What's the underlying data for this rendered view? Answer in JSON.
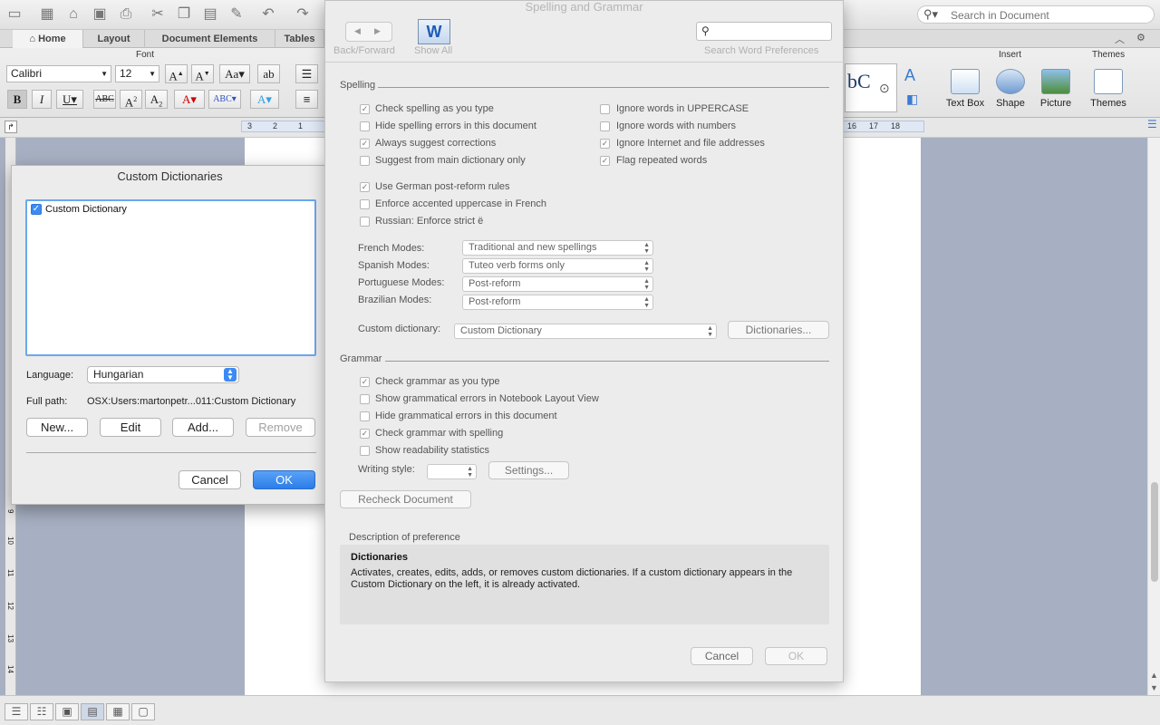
{
  "toolbar": {
    "search_placeholder": "Search in Document"
  },
  "tabs": [
    "Home",
    "Layout",
    "Document Elements",
    "Tables"
  ],
  "ribbon": {
    "font_group_title": "Font",
    "font_name": "Calibri",
    "font_size": "12",
    "insert_group_title": "Insert",
    "themes_group_title": "Themes",
    "text_box": "Text Box",
    "shape": "Shape",
    "picture": "Picture",
    "themes": "Themes",
    "style_preview": "bC"
  },
  "ruler": {
    "left_marks": [
      "3",
      "2",
      "1"
    ],
    "right_marks": [
      "16",
      "17",
      "18"
    ]
  },
  "vruler": {
    "marks": [
      "9",
      "10",
      "11",
      "12",
      "13",
      "14"
    ]
  },
  "custom_dictionaries": {
    "title": "Custom Dictionaries",
    "items": [
      {
        "label": "Custom Dictionary",
        "checked": true
      }
    ],
    "language_label": "Language:",
    "language_value": "Hungarian",
    "fullpath_label": "Full path:",
    "fullpath_value": "OSX:Users:martonpetr...011:Custom Dictionary",
    "new": "New...",
    "edit": "Edit",
    "add": "Add...",
    "remove": "Remove",
    "cancel": "Cancel",
    "ok": "OK"
  },
  "spelling_grammar": {
    "title": "Spelling and Grammar",
    "back_forward": "Back/Forward",
    "show_all": "Show All",
    "search_caption": "Search Word Preferences",
    "spelling_section": "Spelling",
    "left_options": [
      {
        "label": "Check spelling as you type",
        "checked": true
      },
      {
        "label": "Hide spelling errors in this document",
        "checked": false
      },
      {
        "label": "Always suggest corrections",
        "checked": true
      },
      {
        "label": "Suggest from main dictionary only",
        "checked": false
      }
    ],
    "right_options": [
      {
        "label": "Ignore words in UPPERCASE",
        "checked": false
      },
      {
        "label": "Ignore words with numbers",
        "checked": false
      },
      {
        "label": "Ignore Internet and file addresses",
        "checked": true
      },
      {
        "label": "Flag repeated words",
        "checked": true
      }
    ],
    "lang_options": [
      {
        "label": "Use German post-reform rules",
        "checked": true
      },
      {
        "label": "Enforce accented uppercase in French",
        "checked": false
      },
      {
        "label": "Russian: Enforce strict ё",
        "checked": false
      }
    ],
    "modes": [
      {
        "label": "French Modes:",
        "value": "Traditional and new spellings"
      },
      {
        "label": "Spanish Modes:",
        "value": "Tuteo verb forms only"
      },
      {
        "label": "Portuguese Modes:",
        "value": "Post-reform"
      },
      {
        "label": "Brazilian Modes:",
        "value": "Post-reform"
      }
    ],
    "custom_dict_label": "Custom dictionary:",
    "custom_dict_value": "Custom Dictionary",
    "dictionaries_button": "Dictionaries...",
    "grammar_section": "Grammar",
    "grammar_options": [
      {
        "label": "Check grammar as you type",
        "checked": true
      },
      {
        "label": "Show grammatical errors in Notebook Layout View",
        "checked": false
      },
      {
        "label": "Hide grammatical errors in this document",
        "checked": false
      },
      {
        "label": "Check grammar with spelling",
        "checked": true
      },
      {
        "label": "Show readability statistics",
        "checked": false
      }
    ],
    "writing_style_label": "Writing style:",
    "settings_button": "Settings...",
    "recheck_button": "Recheck Document",
    "description_caption": "Description of preference",
    "description_title": "Dictionaries",
    "description_text": "Activates, creates, edits, adds, or removes custom dictionaries. If a custom dictionary appears in the Custom Dictionary on the left, it is already activated.",
    "cancel": "Cancel",
    "ok": "OK"
  }
}
